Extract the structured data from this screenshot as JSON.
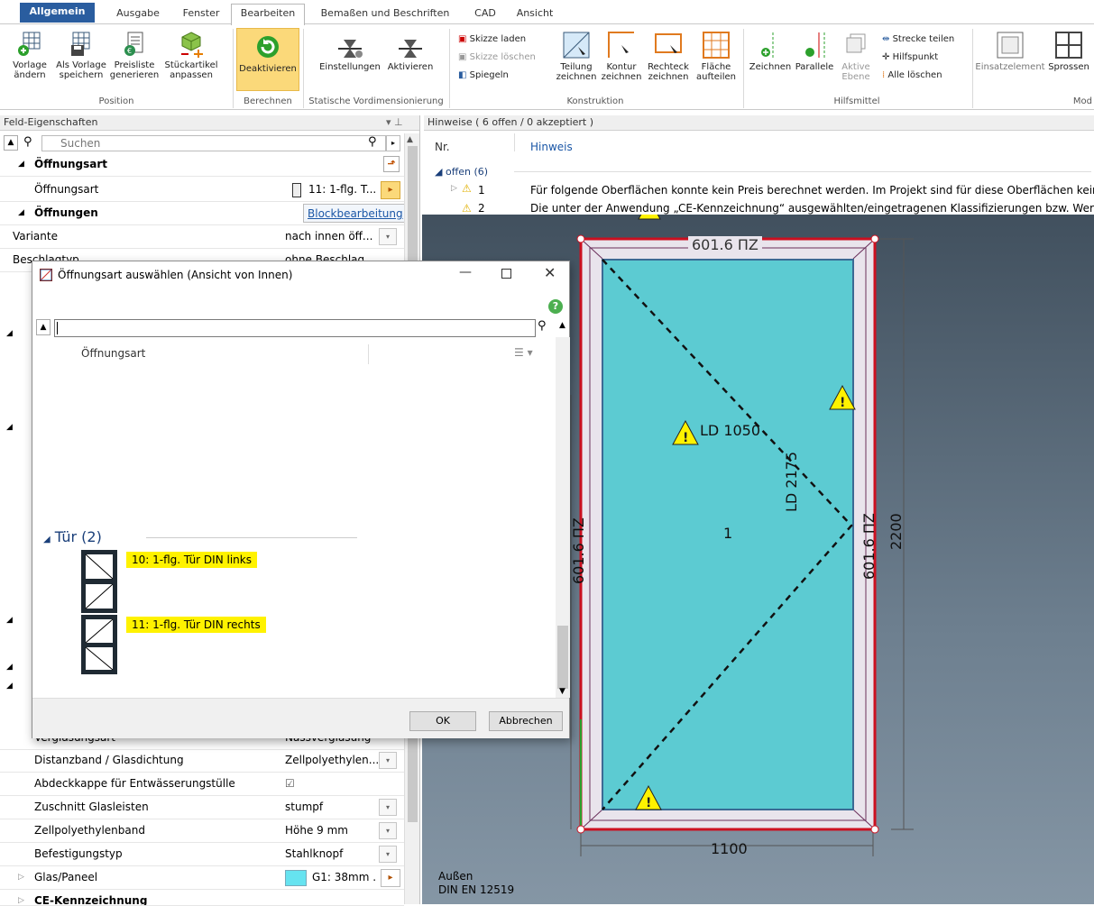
{
  "ribbon": {
    "tabs": [
      "Allgemein",
      "Ausgabe",
      "Fenster",
      "Bearbeiten",
      "Bemaßen und Beschriften",
      "CAD",
      "Ansicht"
    ],
    "groups": {
      "position": "Position",
      "berechnen": "Berechnen",
      "statisch": "Statische Vordimensionierung",
      "konstruktion": "Konstruktion",
      "hilfsmittel": "Hilfsmittel",
      "mod": "Mod"
    },
    "buttons": {
      "vorlage_aendern": [
        "Vorlage",
        "ändern"
      ],
      "als_vorlage": [
        "Als Vorlage",
        "speichern"
      ],
      "preisliste": [
        "Preisliste",
        "generieren"
      ],
      "stueckartikel": [
        "Stückartikel",
        "anpassen"
      ],
      "deaktivieren": "Deaktivieren",
      "einstellungen": "Einstellungen",
      "aktivieren": "Aktivieren",
      "skizze_laden": "Skizze laden",
      "skizze_loeschen": "Skizze löschen",
      "spiegeln": "Spiegeln",
      "teilung": [
        "Teilung",
        "zeichnen"
      ],
      "kontur": [
        "Kontur",
        "zeichnen"
      ],
      "rechteck": [
        "Rechteck",
        "zeichnen"
      ],
      "flaeche": [
        "Fläche",
        "aufteilen"
      ],
      "zeichnen": "Zeichnen",
      "parallele": "Parallele",
      "aktive_ebene": [
        "Aktive",
        "Ebene"
      ],
      "strecke_teilen": "Strecke teilen",
      "hilfspunkt": "Hilfspunkt",
      "alle_loeschen": "Alle löschen",
      "einsatzelement": "Einsatzelement",
      "sprossen": "Sprossen"
    }
  },
  "props": {
    "title": "Feld-Eigenschaften",
    "search_placeholder": "Suchen",
    "cat_oeffnungsart": "Öffnungsart",
    "oeffnungsart_label": "Öffnungsart",
    "oeffnungsart_value": "11: 1-flg. T...",
    "cat_oeffnungen": "Öffnungen",
    "blockbearbeitung": "Blockbearbeitung",
    "variante_label": "Variante",
    "variante_value": "nach innen öff...",
    "beschlag_label": "Beschlagtyp",
    "beschlag_value": "ohne Beschlag",
    "verglasung_label": "Verglasungsart",
    "verglasung_value": "Nassverglasung",
    "rows": [
      {
        "label": "Distanzband / Glasdichtung",
        "value": "Zellpolyethylen..."
      },
      {
        "label": "Abdeckkappe für Entwässerungstülle",
        "value": "☑"
      },
      {
        "label": "Zuschnitt Glasleisten",
        "value": "stumpf"
      },
      {
        "label": "Zellpolyethylenband",
        "value": "Höhe 9 mm"
      },
      {
        "label": "Befestigungstyp",
        "value": "Stahlknopf"
      }
    ],
    "glas_label": "Glas/Paneel",
    "glas_value": "G1: 38mm ...",
    "ce_label": "CE-Kennzeichnung"
  },
  "hints": {
    "title": "Hinweise ( 6 offen / 0 akzeptiert )",
    "col_nr": "Nr.",
    "col_hinweis": "Hinweis",
    "group": "offen (6)",
    "items": [
      {
        "nr": "1",
        "text": "Für folgende Oberflächen konnte kein Preis berechnet werden. Im Projekt sind für diese Oberflächen keine"
      },
      {
        "nr": "2",
        "text": "Die unter der Anwendung „CE-Kennzeichnung“ ausgewählten/eingetragenen Klassifizierungen bzw. Werte"
      }
    ]
  },
  "drawing": {
    "top_dim": "601.6 ПZ",
    "ld_width": "LD 1050",
    "ld_height": "LD 2175",
    "left_dim": "601.6 ПZ",
    "right_dim": "601.6 ПZ",
    "height": "2200",
    "width": "1100",
    "field_no": "1",
    "bottom_line1": "Außen",
    "bottom_line2": "DIN EN 12519"
  },
  "dialog": {
    "title": "Öffnungsart auswählen (Ansicht von Innen)",
    "column": "Öffnungsart",
    "group": "Tür (2)",
    "items": [
      "10: 1-flg. Tür DIN links",
      "11: 1-flg. Tür DIN rechts"
    ],
    "ok": "OK",
    "cancel": "Abbrechen"
  }
}
